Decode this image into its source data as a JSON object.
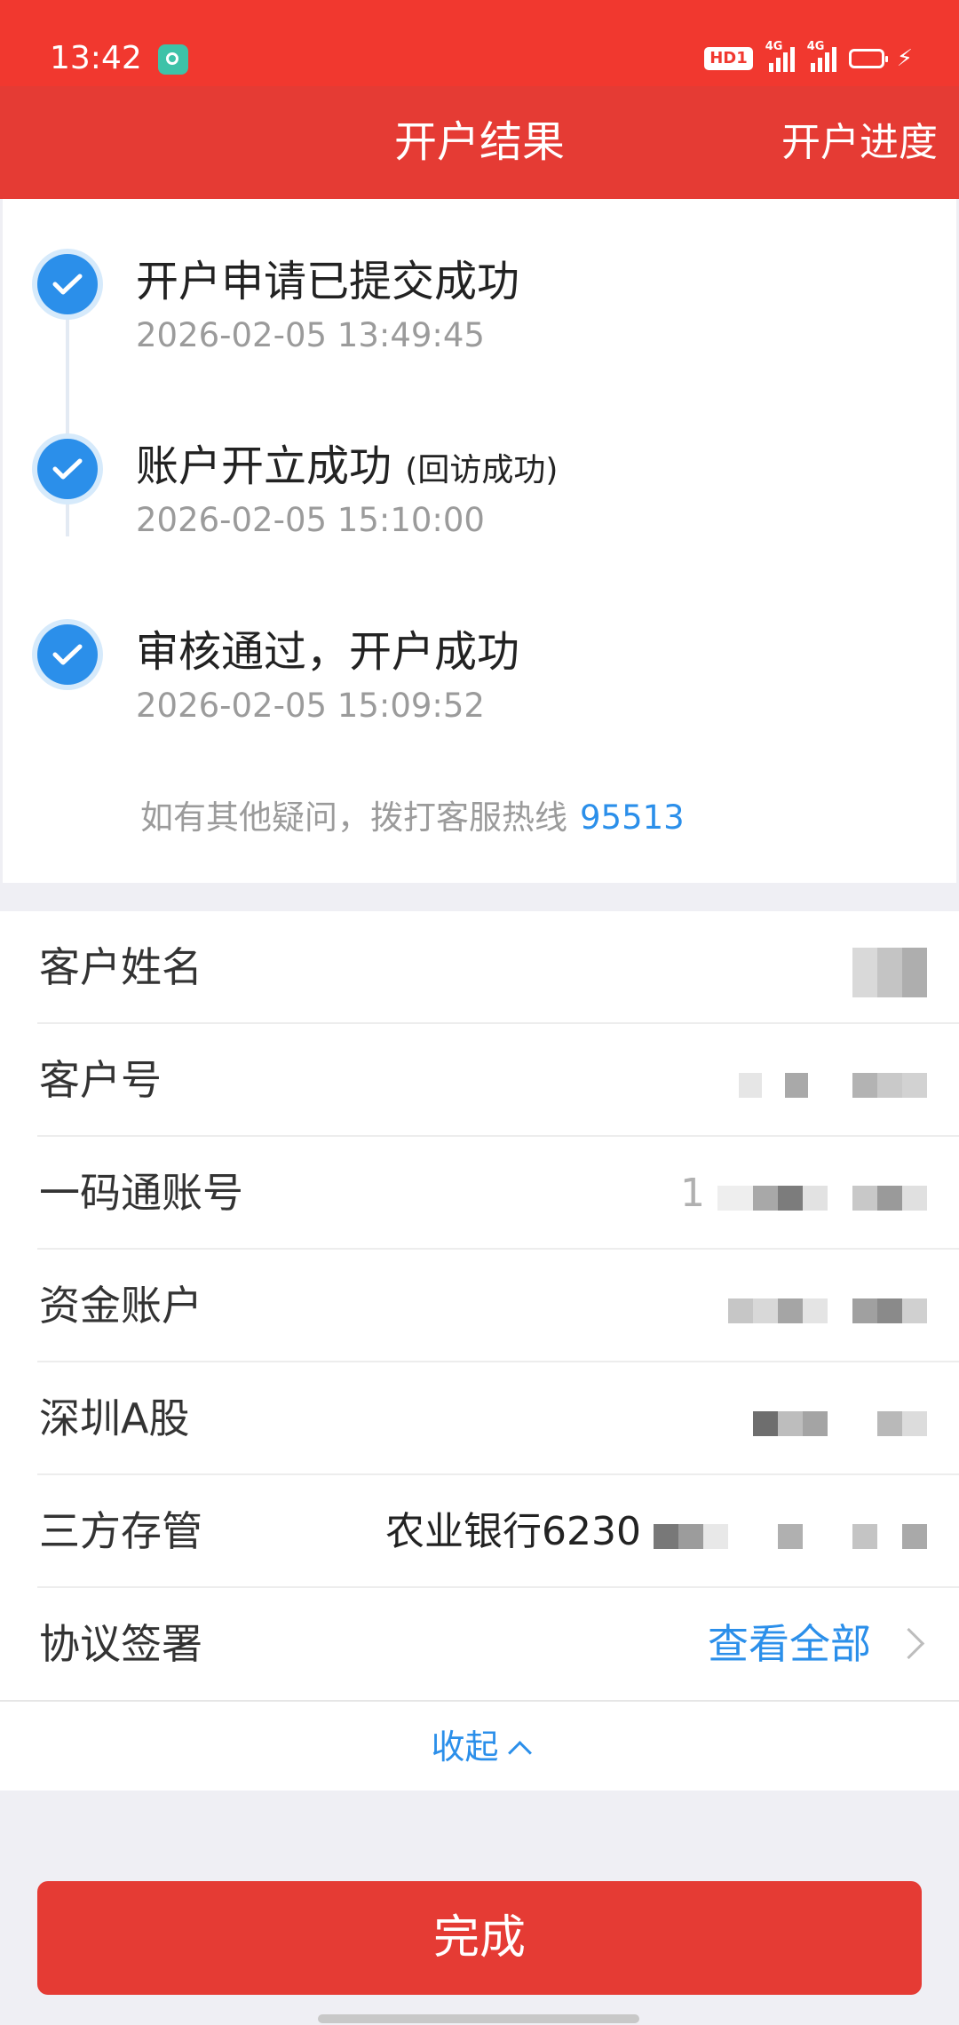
{
  "status_bar": {
    "time": "13:42",
    "hd_badge": "HD1",
    "network_1": "4G",
    "network_2": "4G",
    "battery_color": "#f7c31a"
  },
  "header": {
    "title": "开户结果",
    "progress_link": "开户进度"
  },
  "timeline": {
    "steps": [
      {
        "title": "开户申请已提交成功",
        "note": "",
        "time": "2026-02-05 13:49:45"
      },
      {
        "title": "账户开立成功",
        "note": "(回访成功)",
        "time": "2026-02-05 15:10:00"
      },
      {
        "title": "审核通过，开户成功",
        "note": "",
        "time": "2026-02-05 15:09:52"
      }
    ],
    "hotline_label": "如有其他疑问，拨打客服热线",
    "hotline_number": "95513"
  },
  "info": {
    "rows": [
      {
        "label": "客户姓名",
        "value_prefix": ""
      },
      {
        "label": "客户号",
        "value_prefix": ""
      },
      {
        "label": "一码通账号",
        "value_prefix": "1"
      },
      {
        "label": "资金账户",
        "value_prefix": ""
      },
      {
        "label": "深圳A股",
        "value_prefix": ""
      },
      {
        "label": "三方存管",
        "value_prefix": "农业银行6230"
      }
    ],
    "agreement_label": "协议签署",
    "view_all": "查看全部",
    "collapse": "收起"
  },
  "actions": {
    "done": "完成"
  },
  "colors": {
    "status_bar": "#f1382f",
    "header": "#e53b34",
    "accent_blue": "#2b8fea",
    "primary_button": "#e53b34"
  }
}
